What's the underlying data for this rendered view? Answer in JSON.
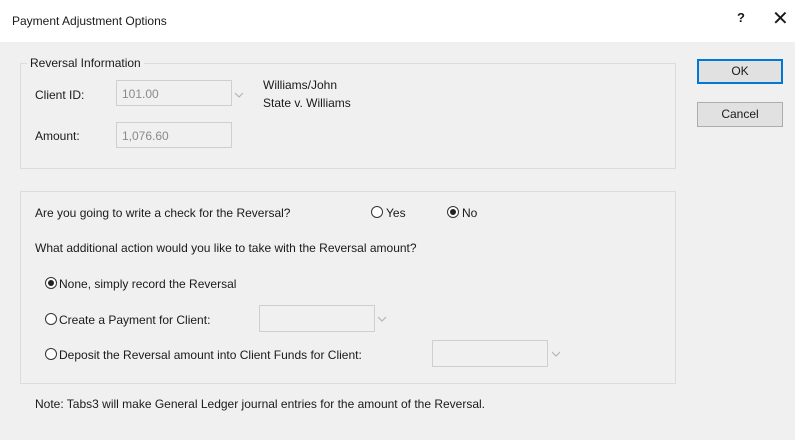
{
  "window": {
    "title": "Payment Adjustment Options",
    "help_label": "?",
    "close_label": "✕"
  },
  "reversal_info": {
    "legend": "Reversal Information",
    "client_id_label": "Client ID:",
    "client_id_value": "101.00",
    "client_name": "Williams/John",
    "client_matter": "State v. Williams",
    "amount_label": "Amount:",
    "amount_value": "1,076.60"
  },
  "buttons": {
    "ok": "OK",
    "cancel": "Cancel"
  },
  "options": {
    "check_question": "Are you going to write a check for the Reversal?",
    "yes_label": "Yes",
    "no_label": "No",
    "check_selected": "No",
    "action_question": "What additional action would you like to take with the Reversal amount?",
    "action_options": [
      "None, simply record the Reversal",
      "Create a Payment for Client:",
      "Deposit the Reversal amount into Client Funds for Client:"
    ],
    "action_selected": 0,
    "payment_client_value": "",
    "deposit_client_value": ""
  },
  "note": "Note:  Tabs3 will make General Ledger journal entries for the amount of the Reversal.",
  "icons": {
    "dropdown": "chevron-down-icon",
    "help": "question-mark-icon",
    "close": "close-icon"
  },
  "colors": {
    "default_button_border": "#0078d7",
    "dialog_background": "#f0f0f0",
    "titlebar_background": "#ffffff"
  }
}
